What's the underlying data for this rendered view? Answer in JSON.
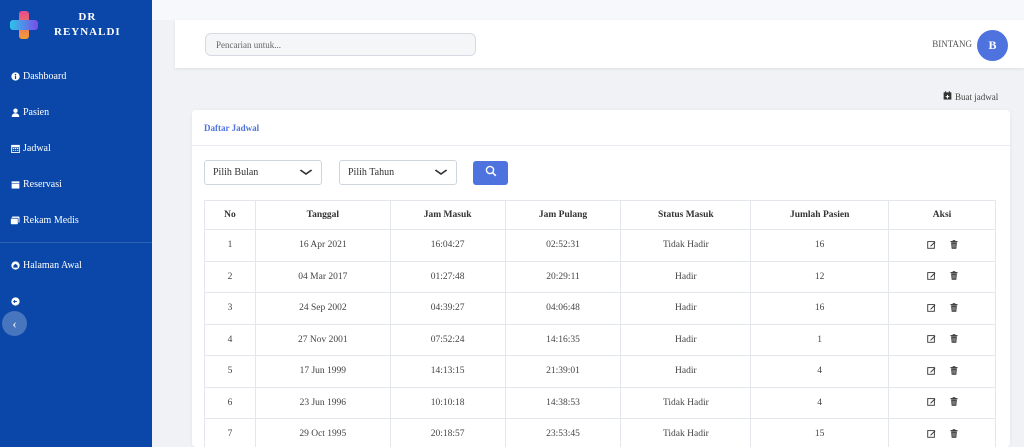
{
  "sidebar": {
    "brand_line1": "DR",
    "brand_line2": "REYNALDI",
    "items": [
      {
        "label": "Dashboard",
        "icon": "info-circle-icon"
      },
      {
        "label": "Pasien",
        "icon": "user-icon"
      },
      {
        "label": "Jadwal",
        "icon": "calendar-icon"
      },
      {
        "label": "Reservasi",
        "icon": "calendar-fill-icon"
      },
      {
        "label": "Rekam Medis",
        "icon": "medical-record-icon"
      },
      {
        "label": "Halaman Awal",
        "icon": "home-icon"
      },
      {
        "label": "",
        "icon": "logout-icon"
      }
    ]
  },
  "topbar": {
    "search_placeholder": "Pencarian untuk...",
    "username": "BINTANG",
    "avatar_initial": "B"
  },
  "actions": {
    "create_schedule": "Buat jadwal"
  },
  "card": {
    "title": "Daftar Jadwal",
    "filter_month": "Pilih Bulan",
    "filter_year": "Pilih Tahun"
  },
  "table": {
    "headers": [
      "No",
      "Tanggal",
      "Jam Masuk",
      "Jam Pulang",
      "Status Masuk",
      "Jumlah Pasien",
      "Aksi"
    ],
    "rows": [
      [
        "1",
        "16 Apr 2021",
        "16:04:27",
        "02:52:31",
        "Tidak Hadir",
        "16"
      ],
      [
        "2",
        "04 Mar 2017",
        "01:27:48",
        "20:29:11",
        "Hadir",
        "12"
      ],
      [
        "3",
        "24 Sep 2002",
        "04:39:27",
        "04:06:48",
        "Hadir",
        "16"
      ],
      [
        "4",
        "27 Nov 2001",
        "07:52:24",
        "14:16:35",
        "Hadir",
        "1"
      ],
      [
        "5",
        "17 Jun 1999",
        "14:13:15",
        "21:39:01",
        "Hadir",
        "4"
      ],
      [
        "6",
        "23 Jun 1996",
        "10:10:18",
        "14:38:53",
        "Tidak Hadir",
        "4"
      ],
      [
        "7",
        "29 Oct 1995",
        "20:18:57",
        "23:53:45",
        "Tidak Hadir",
        "15"
      ]
    ]
  },
  "colors": {
    "sidebar": "#0a47a9",
    "accent": "#4e73df"
  }
}
